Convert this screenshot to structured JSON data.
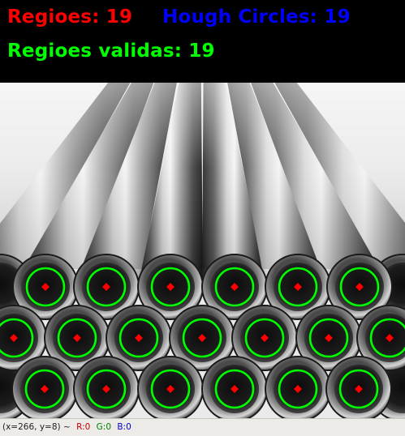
{
  "overlay": {
    "regioes": {
      "text": "Regioes: 19",
      "color": "#ff0000"
    },
    "hough": {
      "text": "Hough Circles: 19",
      "color": "#0000ff"
    },
    "validas": {
      "text": "Regioes validas: 19",
      "color": "#00ff00"
    }
  },
  "detections": {
    "circle_color": "#00ff00",
    "center_color": "#ff0000",
    "count": 19
  },
  "status": {
    "coords": "(x=266, y=8) ~",
    "r": "R:0",
    "g": "G:0",
    "b": "B:0",
    "r_color": "#cc0000",
    "g_color": "#008000",
    "b_color": "#0000cc"
  }
}
